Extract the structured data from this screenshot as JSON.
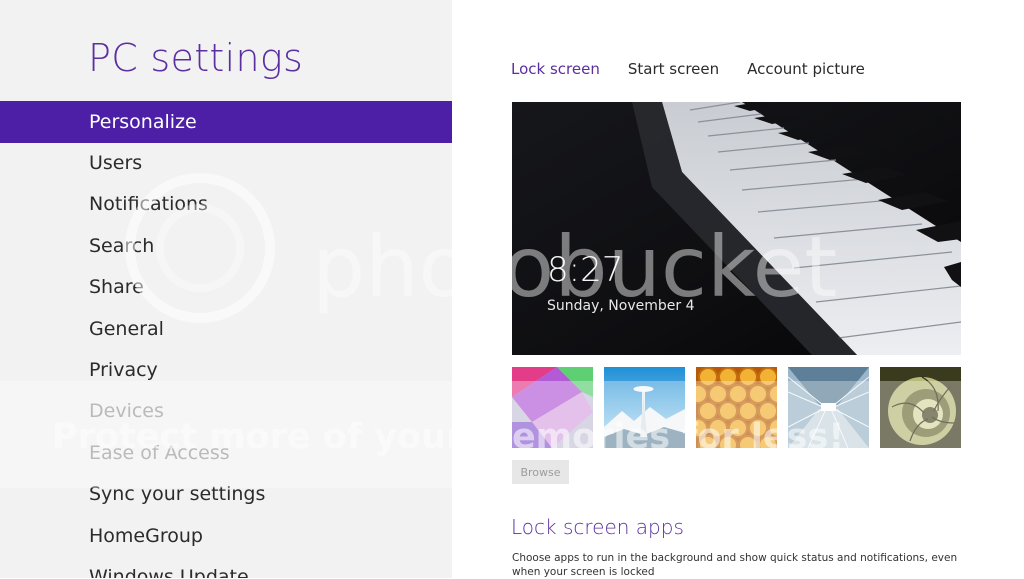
{
  "settings": {
    "title": "PC settings",
    "nav": [
      {
        "label": "Personalize",
        "state": "active"
      },
      {
        "label": "Users",
        "state": "normal"
      },
      {
        "label": "Notifications",
        "state": "normal"
      },
      {
        "label": "Search",
        "state": "normal"
      },
      {
        "label": "Share",
        "state": "normal"
      },
      {
        "label": "General",
        "state": "normal"
      },
      {
        "label": "Privacy",
        "state": "normal"
      },
      {
        "label": "Devices",
        "state": "disabled"
      },
      {
        "label": "Ease of Access",
        "state": "disabled"
      },
      {
        "label": "Sync your settings",
        "state": "normal"
      },
      {
        "label": "HomeGroup",
        "state": "normal"
      },
      {
        "label": "Windows Update",
        "state": "normal"
      }
    ]
  },
  "tabs": [
    {
      "label": "Lock screen",
      "active": true
    },
    {
      "label": "Start screen",
      "active": false
    },
    {
      "label": "Account picture",
      "active": false
    }
  ],
  "preview": {
    "time": "8:27",
    "date": "Sunday, November 4",
    "image": "piano-keys"
  },
  "thumbnails": [
    {
      "name": "geometric-colors"
    },
    {
      "name": "space-needle"
    },
    {
      "name": "honeycomb"
    },
    {
      "name": "glass-tunnel"
    },
    {
      "name": "nautilus-shell"
    }
  ],
  "browse_label": "Browse",
  "lock_apps": {
    "title": "Lock screen apps",
    "description": "Choose apps to run in the background and show quick status and notifications, even when your screen is locked"
  },
  "watermark": {
    "brand": "photobucket",
    "slogan": "Protect more of your memories for less!"
  },
  "colors": {
    "accent": "#4c1fa6",
    "title": "#5b2fa0",
    "left_bg": "#f2f2f2"
  }
}
